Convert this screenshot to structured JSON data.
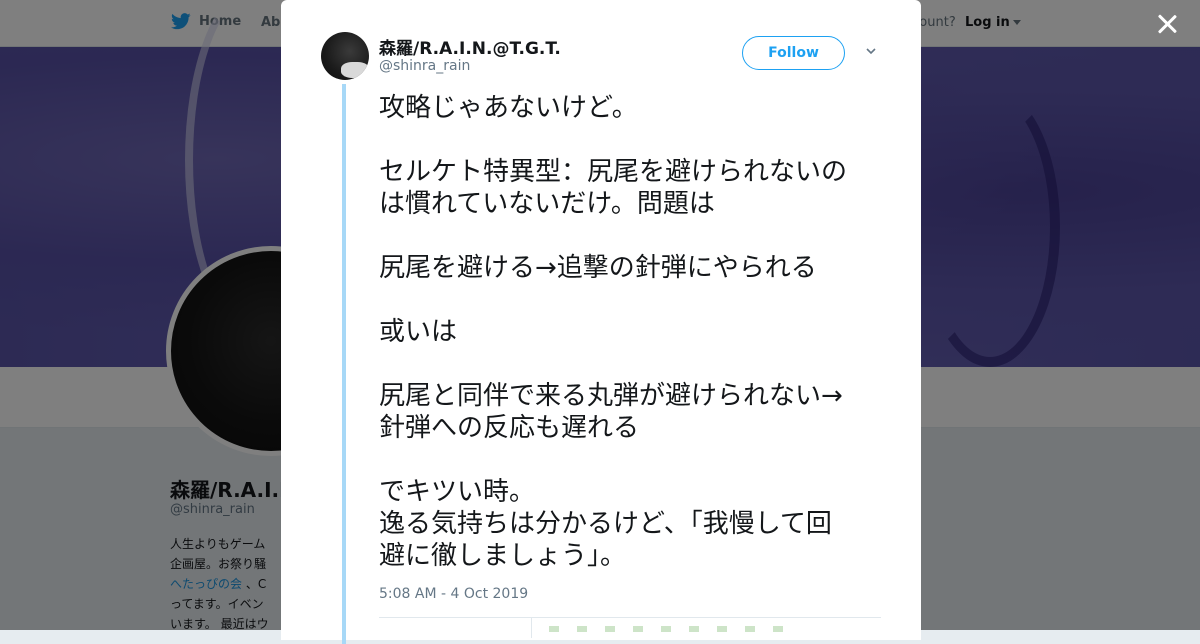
{
  "nav": {
    "home_label": "Home",
    "about_label": "Abo",
    "account_text": "ccount?",
    "login_label": "Log in"
  },
  "profile": {
    "name": "森羅/R.A.I.N",
    "handle": "@shinra_rain",
    "bio_lines": [
      "人生よりもゲーム",
      "企画屋。お祭り騒",
      "",
      "ってます。イベン",
      "います。 最近はウ"
    ],
    "bio_link": "へたっぴの会",
    "bio_link_suffix": " 、C"
  },
  "tweet": {
    "author_name": "森羅/R.A.I.N.@T.G.T.",
    "author_handle": "@shinra_rain",
    "follow_label": "Follow",
    "text": "攻略じゃあないけど。\n\nセルケト特異型：尻尾を避けられないの\nは慣れていないだけ。問題は\n\n尻尾を避ける→追撃の針弾にやられる\n\n或いは\n\n尻尾と同伴で来る丸弾が避けられない→\n針弾への反応も遅れる\n\nでキツい時。\n逸る気持ちは分かるけど、「我慢して回\n避に徹しましょう」。",
    "timestamp": "5:08 AM - 4 Oct 2019"
  },
  "icons": {
    "brand": "twitter-bird-icon",
    "close": "close-icon",
    "menu": "chevron-down-icon"
  },
  "colors": {
    "accent": "#1da1f2",
    "thread_line": "#a7d8f7",
    "banner": "#5a55a9"
  }
}
